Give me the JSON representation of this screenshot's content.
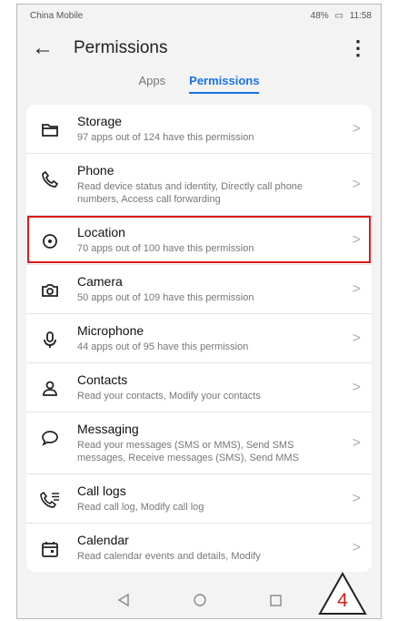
{
  "status": {
    "carrier": "China Mobile",
    "right": "48%",
    "time": "11:58"
  },
  "header": {
    "title": "Permissions"
  },
  "tabs": [
    {
      "label": "Apps",
      "active": false
    },
    {
      "label": "Permissions",
      "active": true
    }
  ],
  "permissions": [
    {
      "title": "Storage",
      "desc": "97 apps out of 124 have this permission",
      "icon": "folder-icon"
    },
    {
      "title": "Phone",
      "desc": "Read device status and identity, Directly call phone numbers, Access call forwarding",
      "icon": "phone-icon"
    },
    {
      "title": "Location",
      "desc": "70 apps out of 100 have this permission",
      "icon": "location-icon",
      "highlighted": true
    },
    {
      "title": "Camera",
      "desc": "50 apps out of 109 have this permission",
      "icon": "camera-icon"
    },
    {
      "title": "Microphone",
      "desc": "44 apps out of 95 have this permission",
      "icon": "microphone-icon"
    },
    {
      "title": "Contacts",
      "desc": "Read your contacts, Modify your contacts",
      "icon": "contacts-icon"
    },
    {
      "title": "Messaging",
      "desc": "Read your messages (SMS or MMS), Send SMS messages, Receive messages (SMS), Send MMS",
      "icon": "message-icon"
    },
    {
      "title": "Call logs",
      "desc": "Read call log, Modify call log",
      "icon": "call-log-icon"
    },
    {
      "title": "Calendar",
      "desc": "Read calendar events and details, Modify",
      "icon": "calendar-icon"
    }
  ],
  "annotation": {
    "step": "4",
    "color": "#d81b1b"
  },
  "colors": {
    "accent": "#1a73e8",
    "highlight": "#d81b1b"
  }
}
